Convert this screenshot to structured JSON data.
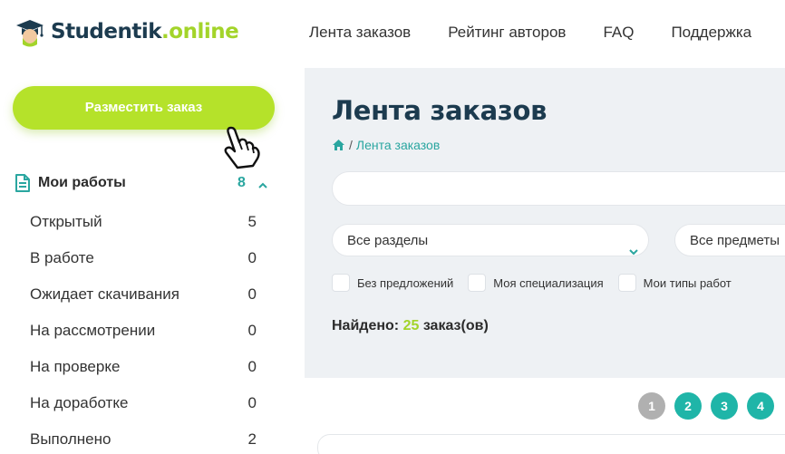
{
  "brand": {
    "name_part1": "Studentik",
    "name_part2": ".online",
    "color_dark": "#1c3b4f",
    "color_accent": "#a3d42a"
  },
  "nav": {
    "items": [
      "Лента заказов",
      "Рейтинг авторов",
      "FAQ",
      "Поддержка"
    ]
  },
  "sidebar": {
    "order_button_label": "Разместить заказ",
    "mywork": {
      "title": "Мои работы",
      "count": "8",
      "icon": "document-icon",
      "expanded": true
    },
    "statuses": [
      {
        "label": "Открытый",
        "count": "5"
      },
      {
        "label": "В работе",
        "count": "0"
      },
      {
        "label": "Ожидает скачивания",
        "count": "0"
      },
      {
        "label": "На рассмотрении",
        "count": "0"
      },
      {
        "label": "На проверке",
        "count": "0"
      },
      {
        "label": "На доработке",
        "count": "0"
      },
      {
        "label": "Выполнено",
        "count": "2"
      }
    ]
  },
  "main": {
    "title": "Лента заказов",
    "breadcrumb": {
      "home_icon": "home-icon",
      "separator": "/",
      "current": "Лента заказов"
    },
    "search": {
      "value": "",
      "placeholder": ""
    },
    "filters": {
      "section_select": "Все разделы",
      "subject_select": "Все предметы"
    },
    "checkboxes": [
      {
        "label": "Без предложений",
        "checked": false
      },
      {
        "label": "Моя специализация",
        "checked": false
      },
      {
        "label": "Мои типы работ",
        "checked": false
      }
    ],
    "found": {
      "prefix": "Найдено:",
      "count": "25",
      "suffix": "заказ(ов)"
    },
    "pagination": {
      "pages": [
        "1",
        "2",
        "3",
        "4"
      ],
      "current": "1"
    }
  },
  "colors": {
    "teal": "#1fb5a8",
    "green_button": "#b5e22a",
    "background_main": "#eef1f4"
  }
}
